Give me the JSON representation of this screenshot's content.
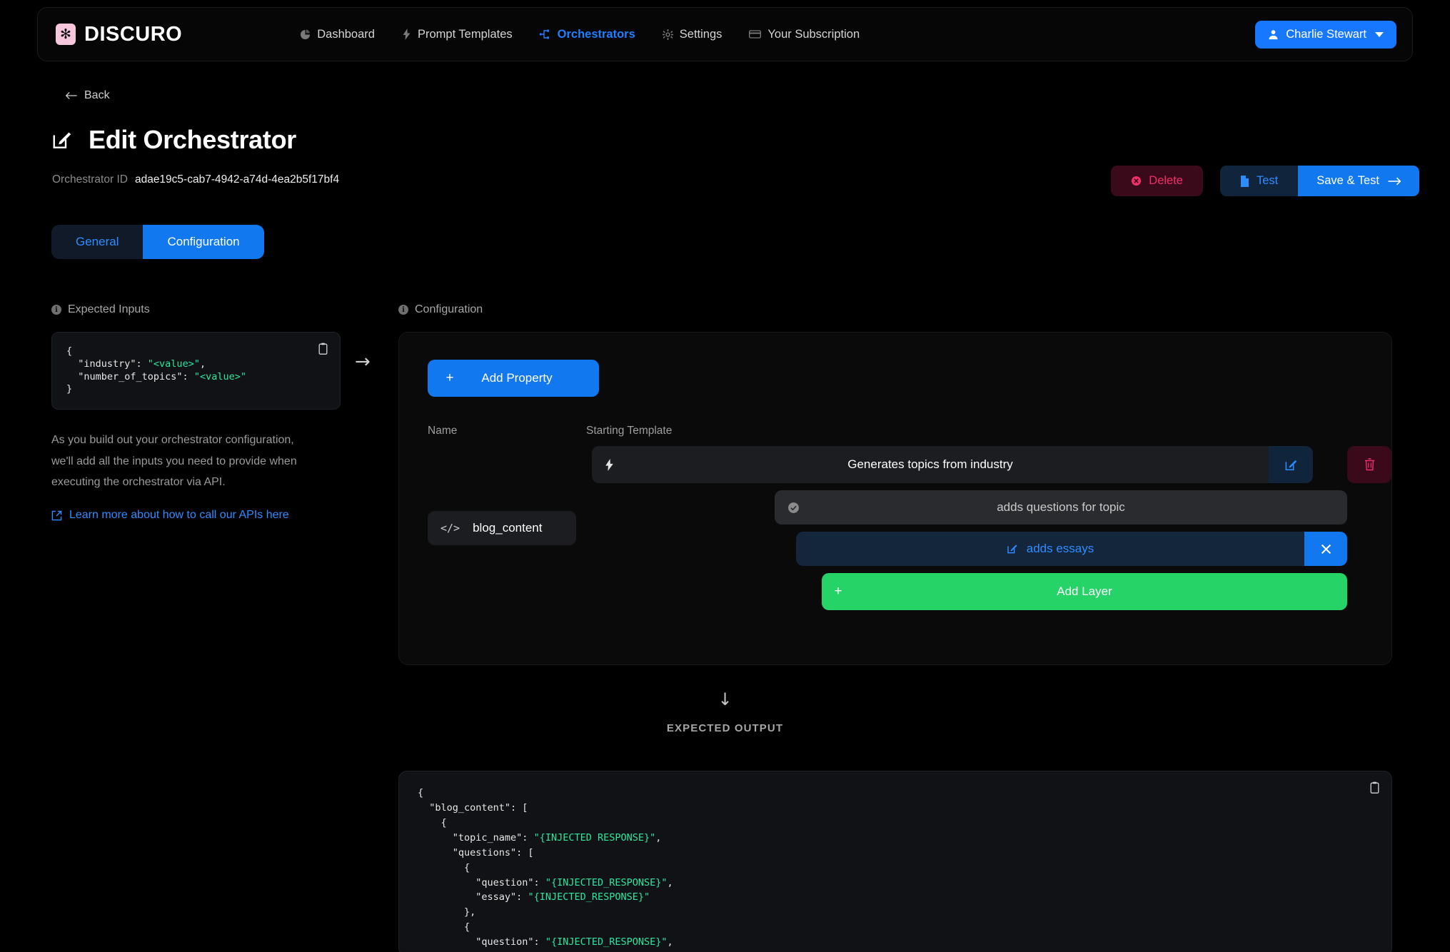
{
  "brand": {
    "name": "DISCURO",
    "logo_icon": "flower-logo-icon",
    "logo_glyph": "✻",
    "accent": "#f6c6dd"
  },
  "nav": {
    "items": [
      {
        "label": "Dashboard",
        "icon": "pie-chart-icon",
        "active": false
      },
      {
        "label": "Prompt Templates",
        "icon": "lightning-bolt-icon",
        "active": false
      },
      {
        "label": "Orchestrators",
        "icon": "sitemap-branch-icon",
        "active": true
      },
      {
        "label": "Settings",
        "icon": "gear-icon",
        "active": false
      },
      {
        "label": "Your Subscription",
        "icon": "credit-card-icon",
        "active": false
      }
    ],
    "user": {
      "name": "Charlie Stewart",
      "icon": "user-icon",
      "caret": "chevron-down-icon"
    }
  },
  "page": {
    "back_label": "Back",
    "back_icon": "arrow-left-icon",
    "title": "Edit Orchestrator",
    "title_icon": "pencil-square-icon",
    "id_label": "Orchestrator ID",
    "id_value": "adae19c5-cab7-4942-a74d-4ea2b5f17bf4"
  },
  "actions": {
    "delete": {
      "label": "Delete",
      "icon": "delete-circle-icon",
      "color": "#ef2f6b"
    },
    "test": {
      "label": "Test",
      "icon": "file-icon",
      "color": "#2f8cff"
    },
    "save": {
      "label": "Save & Test",
      "icon": "arrow-right-icon",
      "color": "#1178f0"
    }
  },
  "tabs": [
    {
      "label": "General",
      "active": false
    },
    {
      "label": "Configuration",
      "active": true
    }
  ],
  "expected_inputs": {
    "heading": "Expected Inputs",
    "copy_icon": "clipboard-copy-icon",
    "code": {
      "l1": "{",
      "l2_key": "  \"industry\": ",
      "l2_val": "\"<value>\"",
      "l2_end": ",",
      "l3_key": "  \"number_of_topics\": ",
      "l3_val": "\"<value>\"",
      "l4": "}"
    },
    "helper_text": "As you build out your orchestrator configuration, we'll add all the inputs you need to provide when executing the orchestrator via API.",
    "learn_more": "Learn more about how to call our APIs here",
    "learn_more_icon": "external-link-icon"
  },
  "flow_arrow": "→",
  "configuration": {
    "heading": "Configuration",
    "add_property": {
      "label": "Add Property",
      "plus": "+"
    },
    "columns": {
      "name": "Name",
      "starting_template": "Starting Template"
    },
    "property": {
      "name_value": "blog_content",
      "name_icon": "code-brackets-icon"
    },
    "layers": [
      {
        "label": "Generates topics from industry",
        "icon": "lightning-bolt-icon",
        "style": "primary",
        "action_icon": "pencil-square-icon"
      },
      {
        "label": "adds questions for topic",
        "icon": "check-circle-icon",
        "style": "muted"
      },
      {
        "label": "adds essays",
        "icon": "pencil-square-icon",
        "style": "selected",
        "action_icon": "close-x-icon"
      }
    ],
    "delete_property_icon": "trash-icon",
    "add_layer": {
      "label": "Add Layer",
      "plus": "+",
      "color": "#25d366"
    }
  },
  "expected_output": {
    "arrow": "↓",
    "caption": "EXPECTED OUTPUT",
    "copy_icon": "clipboard-copy-icon",
    "lines": [
      {
        "text": "{",
        "parts": [
          {
            "t": "{",
            "c": "plain"
          }
        ]
      },
      {
        "parts": [
          {
            "t": "  \"blog_content\": [",
            "c": "plain"
          }
        ]
      },
      {
        "parts": [
          {
            "t": "    {",
            "c": "plain"
          }
        ]
      },
      {
        "parts": [
          {
            "t": "      \"topic_name\": ",
            "c": "plain"
          },
          {
            "t": "\"{INJECTED RESPONSE}\"",
            "c": "str"
          },
          {
            "t": ",",
            "c": "plain"
          }
        ]
      },
      {
        "parts": [
          {
            "t": "      \"questions\": [",
            "c": "plain"
          }
        ]
      },
      {
        "parts": [
          {
            "t": "        {",
            "c": "plain"
          }
        ]
      },
      {
        "parts": [
          {
            "t": "          \"question\": ",
            "c": "plain"
          },
          {
            "t": "\"{INJECTED_RESPONSE}\"",
            "c": "str"
          },
          {
            "t": ",",
            "c": "plain"
          }
        ]
      },
      {
        "parts": [
          {
            "t": "          \"essay\": ",
            "c": "plain"
          },
          {
            "t": "\"{INJECTED_RESPONSE}\"",
            "c": "str"
          }
        ]
      },
      {
        "parts": [
          {
            "t": "        },",
            "c": "plain"
          }
        ]
      },
      {
        "parts": [
          {
            "t": "        {",
            "c": "plain"
          }
        ]
      },
      {
        "parts": [
          {
            "t": "          \"question\": ",
            "c": "plain"
          },
          {
            "t": "\"{INJECTED_RESPONSE}\"",
            "c": "str"
          },
          {
            "t": ",",
            "c": "plain"
          }
        ]
      }
    ]
  }
}
